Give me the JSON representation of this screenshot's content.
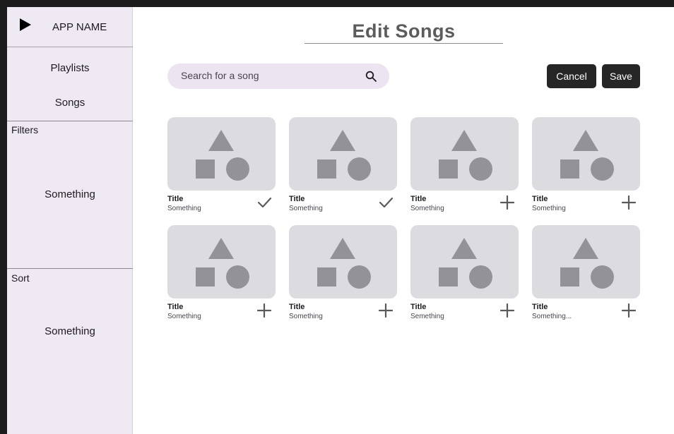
{
  "sidebar": {
    "app_name": "APP NAME",
    "nav": [
      {
        "label": "Playlists"
      },
      {
        "label": "Songs"
      }
    ],
    "filters": {
      "label": "Filters",
      "value": "Something"
    },
    "sort": {
      "label": "Sort",
      "value": "Something"
    }
  },
  "main": {
    "title": "Edit Songs",
    "search": {
      "placeholder": "Search for a song",
      "value": ""
    },
    "actions": {
      "cancel": "Cancel",
      "save": "Save"
    },
    "songs": [
      {
        "title": "Title",
        "subtitle": "Something",
        "action": "check-icon"
      },
      {
        "title": "Title",
        "subtitle": "Something",
        "action": "check-icon"
      },
      {
        "title": "Title",
        "subtitle": "Something",
        "action": "add-icon"
      },
      {
        "title": "Title",
        "subtitle": "Something",
        "action": "add-icon"
      },
      {
        "title": "Title",
        "subtitle": "Something",
        "action": "add-icon"
      },
      {
        "title": "Title",
        "subtitle": "Something",
        "action": "add-icon"
      },
      {
        "title": "Title",
        "subtitle": "Semething",
        "action": "add-icon"
      },
      {
        "title": "Title",
        "subtitle": "Something...",
        "action": "add-icon"
      }
    ]
  },
  "colors": {
    "sidebar_bg": "#efe9f3",
    "search_bg": "#ece4f0",
    "button_bg": "#262626",
    "thumb_bg": "#dcdce0",
    "thumb_shape": "#939397",
    "icon": "#5a5a5a"
  }
}
